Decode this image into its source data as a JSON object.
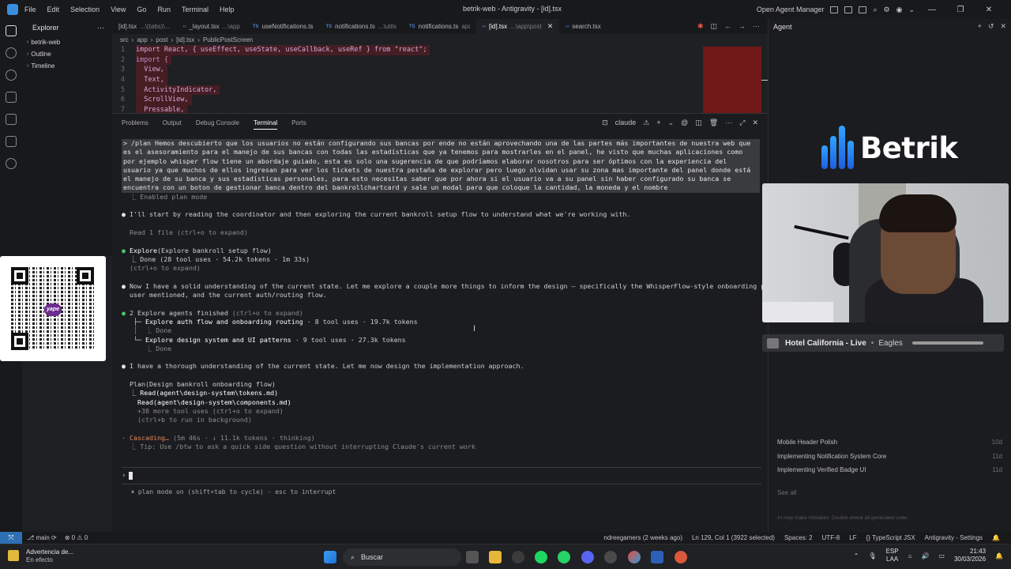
{
  "window": {
    "menu": [
      "File",
      "Edit",
      "Selection",
      "View",
      "Go",
      "Run",
      "Terminal",
      "Help"
    ],
    "title": "betrik-web - Antigravity - [id].tsx",
    "open_agent_manager": "Open Agent Manager"
  },
  "sidebar": {
    "title": "Explorer",
    "more": "···",
    "items": [
      "betrik-web",
      "Outline",
      "Timeline"
    ]
  },
  "qr": {
    "brand": "yape"
  },
  "tabs": [
    {
      "name": "[id].tsx",
      "sub": "...\\(tabs)\\..."
    },
    {
      "name": "_layout.tsx",
      "sub": "...\\app"
    },
    {
      "name": "useNotifications.ts",
      "sub": ""
    },
    {
      "name": "notifications.ts",
      "sub": "...\\utils"
    },
    {
      "name": "notifications.ts",
      "sub": "api"
    },
    {
      "name": "[id].tsx",
      "sub": "...\\app\\post"
    },
    {
      "name": "search.tsx",
      "sub": ""
    }
  ],
  "breadcrumb": [
    "src",
    "app",
    "post",
    "[id].tsx",
    "PublicPostScreen"
  ],
  "code": [
    {
      "n": "1",
      "t": "import React, { useEffect, useState, useCallback, useRef } from \"react\";"
    },
    {
      "n": "2",
      "t": "import {"
    },
    {
      "n": "3",
      "t": "  View,"
    },
    {
      "n": "4",
      "t": "  Text,"
    },
    {
      "n": "5",
      "t": "  ActivityIndicator,"
    },
    {
      "n": "6",
      "t": "  ScrollView,"
    },
    {
      "n": "7",
      "t": "  Pressable,"
    }
  ],
  "panel": {
    "tabs": [
      "Problems",
      "Output",
      "Debug Console",
      "Terminal",
      "Ports"
    ],
    "active": "Terminal",
    "terminal_name": "claude"
  },
  "terminal": {
    "prompt": "> /plan Hemos descubierto que los usuarios no están configurando sus bancas por ende no están aprovechando una de las partes más importantes de nuestra web que es el asesoramiento para el manejo de sus bancas con todas las estadísticas que ya tenemos para mostrarles en el panel, he visto que muchas aplicaciones como por ejemplo whisper flow tiene un abordaje guiado, esta es solo una sugerencia de que podríamos elaborar nosotros para ser óptimos con la experiencia del usuario ya que muchos de ellos ingresan para ver los tickets de nuestra pestaña de explorar pero luego olvidan usar su zona mas importante del panel donde está el manejo de su banca y sus estadísticas personales, para esto necesitas saber que por ahora si el usuario va a su panel sin haber configurado su banca se encuentra con un boton de gestionar banca dentro del bankrollchartcard y sale un modal para que coloque la cantidad, la moneda y el nombre",
    "enabled": "  ⎿ Enabled plan mode",
    "msg1": "I'll start by reading the coordinator and then exploring the current bankroll setup flow to understand what we're working with.",
    "read1": "Read 1 file (ctrl+o to expand)",
    "explore_title": "Explore",
    "explore_args": "(Explore bankroll setup flow)",
    "explore_done": "  ⎿ Done (28 tool uses · 54.2k tokens · 1m 33s)",
    "explore_hint": "(ctrl+o to expand)",
    "msg2a": "Now I have a solid understanding of the current state. Let me explore a couple more things to inform the design — specifically the WhisperFlow-style onboarding pattern the",
    "msg2b": "user mentioned, and the current auth/routing flow.",
    "agents_title": "2 Explore agents finished",
    "agents_hint": "(ctrl+o to expand)",
    "agent1": "Explore auth flow and onboarding routing",
    "agent1_meta": "· 8 tool uses · 19.7k tokens",
    "agent1_done": "Done",
    "agent2": "Explore design system and UI patterns",
    "agent2_meta": "· 9 tool uses · 27.3k tokens",
    "agent2_done": "Done",
    "msg3": "I have a thorough understanding of the current state. Let me now design the implementation approach.",
    "plan_title": "Plan(Design bankroll onboarding flow)",
    "plan_read1": "Read(agent\\design-system\\tokens.md)",
    "plan_read2": "Read(agent\\design-system\\components.md)",
    "plan_more": "+38 more tool uses (ctrl+o to expand)",
    "plan_bg": "(ctrl+b to run in background)",
    "cascading": "Cascading…",
    "cascading_meta": "(5m 46s · ↓ 11.1k tokens · thinking)",
    "tip": "  ⎿ Tip: Use /btw to ask a quick side question without interrupting Claude's current work",
    "mode": "⏸ plan mode on (shift+tab to cycle) · esc to interrupt"
  },
  "agent": {
    "title": "Agent",
    "brand_name": "Betrik",
    "music": {
      "song": "Hotel California - Live",
      "artist": "Eagles"
    },
    "conversations": [
      {
        "title": "Mobile Header Polish",
        "age": "10d"
      },
      {
        "title": "Implementing Notification System Core",
        "age": "11d"
      },
      {
        "title": "Implementing Verified Badge UI",
        "age": "11d"
      }
    ],
    "see_all": "See all",
    "disclaimer": "AI may make mistakes. Double-check all generated code."
  },
  "statusbar": {
    "branch": "main",
    "errors": "0",
    "warnings": "0",
    "git_author": "ndreegamers (2 weeks ago)",
    "position": "Ln 129, Col 1 (3922 selected)",
    "spaces": "Spaces: 2",
    "encoding": "UTF-8",
    "eol": "LF",
    "language": "TypeScript JSX",
    "settings": "Antigravity - Settings"
  },
  "taskbar": {
    "notif_title": "Advertencia de...",
    "notif_sub": "En efecto",
    "search": "Buscar",
    "lang1": "ESP",
    "lang2": "LAA",
    "time": "21:43",
    "date": "30/03/2026"
  }
}
